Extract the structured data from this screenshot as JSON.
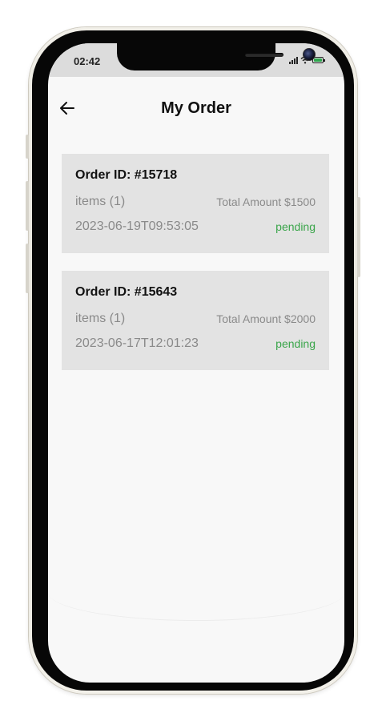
{
  "status_bar": {
    "time": "02:42",
    "battery_level": 1.0,
    "battery_color": "#2fa84f"
  },
  "header": {
    "back_icon": "arrow-left-icon",
    "title": "My Order"
  },
  "orders": [
    {
      "id_label": "Order ID: #15718",
      "items_label": "items (1)",
      "amount_label": "Total Amount $1500",
      "date": "2023-06-19T09:53:05",
      "status": "pending"
    },
    {
      "id_label": "Order ID: #15643",
      "items_label": "items (1)",
      "amount_label": "Total Amount $2000",
      "date": "2023-06-17T12:01:23",
      "status": "pending"
    }
  ],
  "colors": {
    "status_pending": "#3aa54a",
    "card_background": "#e3e3e3",
    "screen_background": "#f8f8f8"
  }
}
